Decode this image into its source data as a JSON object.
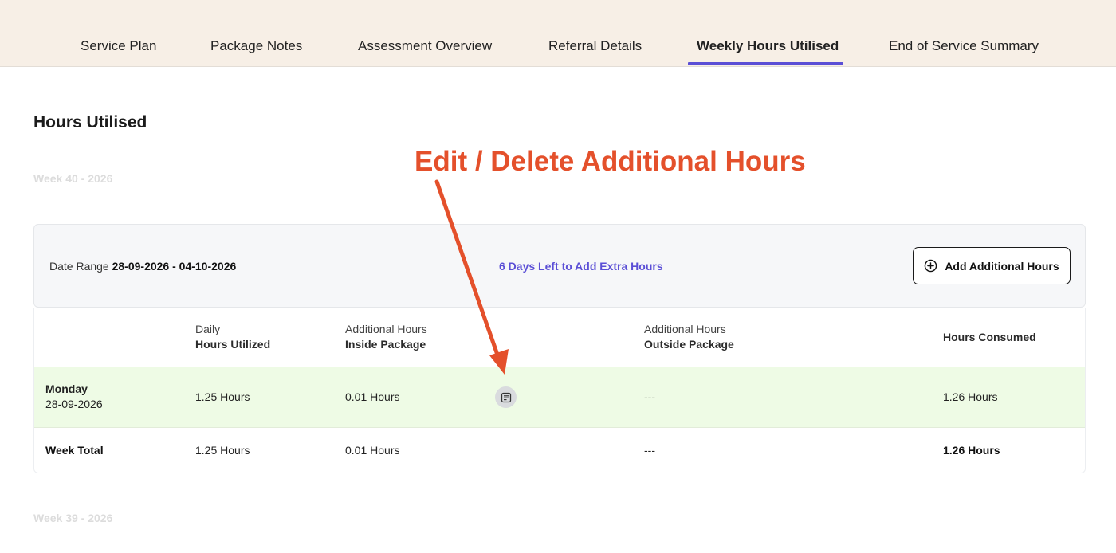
{
  "tabs": [
    {
      "label": "Service Plan"
    },
    {
      "label": "Package Notes"
    },
    {
      "label": "Assessment Overview"
    },
    {
      "label": "Referral Details"
    },
    {
      "label": "Weekly Hours Utilised",
      "active": true
    },
    {
      "label": "End of Service Summary"
    }
  ],
  "section_title": "Hours Utilised",
  "annotation": "Edit / Delete Additional Hours",
  "weeks": [
    {
      "label": "Week 40 - 2026"
    },
    {
      "label": "Week 39 - 2026"
    }
  ],
  "range": {
    "label": "Date Range",
    "value": "28-09-2026 - 04-10-2026",
    "days_left": "6 Days Left to Add Extra Hours",
    "add_button": "Add Additional Hours"
  },
  "table": {
    "headers": {
      "daily_top": "Daily",
      "daily_bottom": "Hours Utilized",
      "inside_top": "Additional Hours",
      "inside_bottom": "Inside Package",
      "outside_top": "Additional Hours",
      "outside_bottom": "Outside Package",
      "consumed": "Hours Consumed"
    },
    "rows": [
      {
        "day": "Monday",
        "date": "28-09-2026",
        "daily": "1.25 Hours",
        "inside": "0.01 Hours",
        "outside": "---",
        "consumed": "1.26 Hours"
      }
    ],
    "total": {
      "label": "Week Total",
      "daily": "1.25 Hours",
      "inside": "0.01 Hours",
      "outside": "---",
      "consumed": "1.26 Hours"
    }
  },
  "colors": {
    "accent": "#5b4fd6",
    "annotation": "#e4502b",
    "tabbar_bg": "#f7efe6",
    "row_highlight": "#eefbe5"
  },
  "icons": {
    "add": "plus-circle-icon",
    "notes": "note-edit-icon"
  }
}
